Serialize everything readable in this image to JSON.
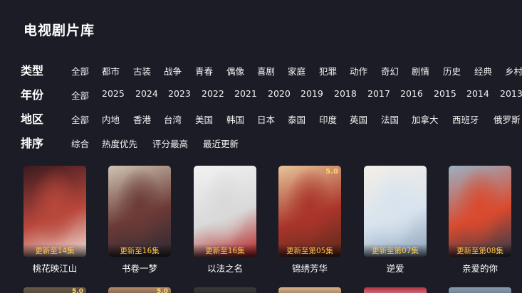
{
  "page_title": "电视剧片库",
  "filters": [
    {
      "label": "类型",
      "options": [
        "全部",
        "都市",
        "古装",
        "战争",
        "青春",
        "偶像",
        "喜剧",
        "家庭",
        "犯罪",
        "动作",
        "奇幻",
        "剧情",
        "历史",
        "经典",
        "乡村"
      ]
    },
    {
      "label": "年份",
      "options": [
        "全部",
        "2025",
        "2024",
        "2023",
        "2022",
        "2021",
        "2020",
        "2019",
        "2018",
        "2017",
        "2016",
        "2015",
        "2014",
        "2013"
      ]
    },
    {
      "label": "地区",
      "options": [
        "全部",
        "内地",
        "香港",
        "台湾",
        "美国",
        "韩国",
        "日本",
        "泰国",
        "印度",
        "英国",
        "法国",
        "加拿大",
        "西班牙",
        "俄罗斯"
      ]
    },
    {
      "label": "排序",
      "options": [
        "综合",
        "热度优先",
        "评分最高",
        "最近更新"
      ]
    }
  ],
  "cards": [
    {
      "title": "桃花映江山",
      "badge": "更新至14集",
      "score": "",
      "colors": [
        "#3a1a1e",
        "#b9473c",
        "#f0e2d8"
      ]
    },
    {
      "title": "书卷一梦",
      "badge": "更新至16集",
      "score": "",
      "colors": [
        "#cfc4b4",
        "#6b3a36",
        "#2c2a33"
      ]
    },
    {
      "title": "以法之名",
      "badge": "更新至16集",
      "score": "",
      "colors": [
        "#f2f2f2",
        "#d9d9d9",
        "#b41e1e"
      ]
    },
    {
      "title": "锦绣芳华",
      "badge": "更新至第05集",
      "score": "5.0",
      "colors": [
        "#e8c59a",
        "#a9352a",
        "#5a2a1c"
      ]
    },
    {
      "title": "逆爱",
      "badge": "更新至第07集",
      "score": "",
      "colors": [
        "#f3eee8",
        "#d8e3ee",
        "#8aa0b8"
      ]
    },
    {
      "title": "亲爱的你",
      "badge": "更新至第08集",
      "score": "",
      "colors": [
        "#9bb1c4",
        "#d94a2e",
        "#2b3a4a"
      ]
    }
  ],
  "second_row": [
    {
      "score": "5.0",
      "colors": [
        "#6a5a4a",
        "#3a2f28"
      ]
    },
    {
      "score": "5.0",
      "colors": [
        "#b48a6a",
        "#4a3a30"
      ]
    },
    {
      "score": "",
      "colors": [
        "#3a3a3a",
        "#1e1e1e"
      ]
    },
    {
      "score": "",
      "colors": [
        "#d9b38c",
        "#6a4a30"
      ]
    },
    {
      "score": "",
      "colors": [
        "#b43040",
        "#e0c0c8"
      ]
    },
    {
      "score": "",
      "colors": [
        "#8a9cb0",
        "#4a5a6a"
      ]
    }
  ]
}
